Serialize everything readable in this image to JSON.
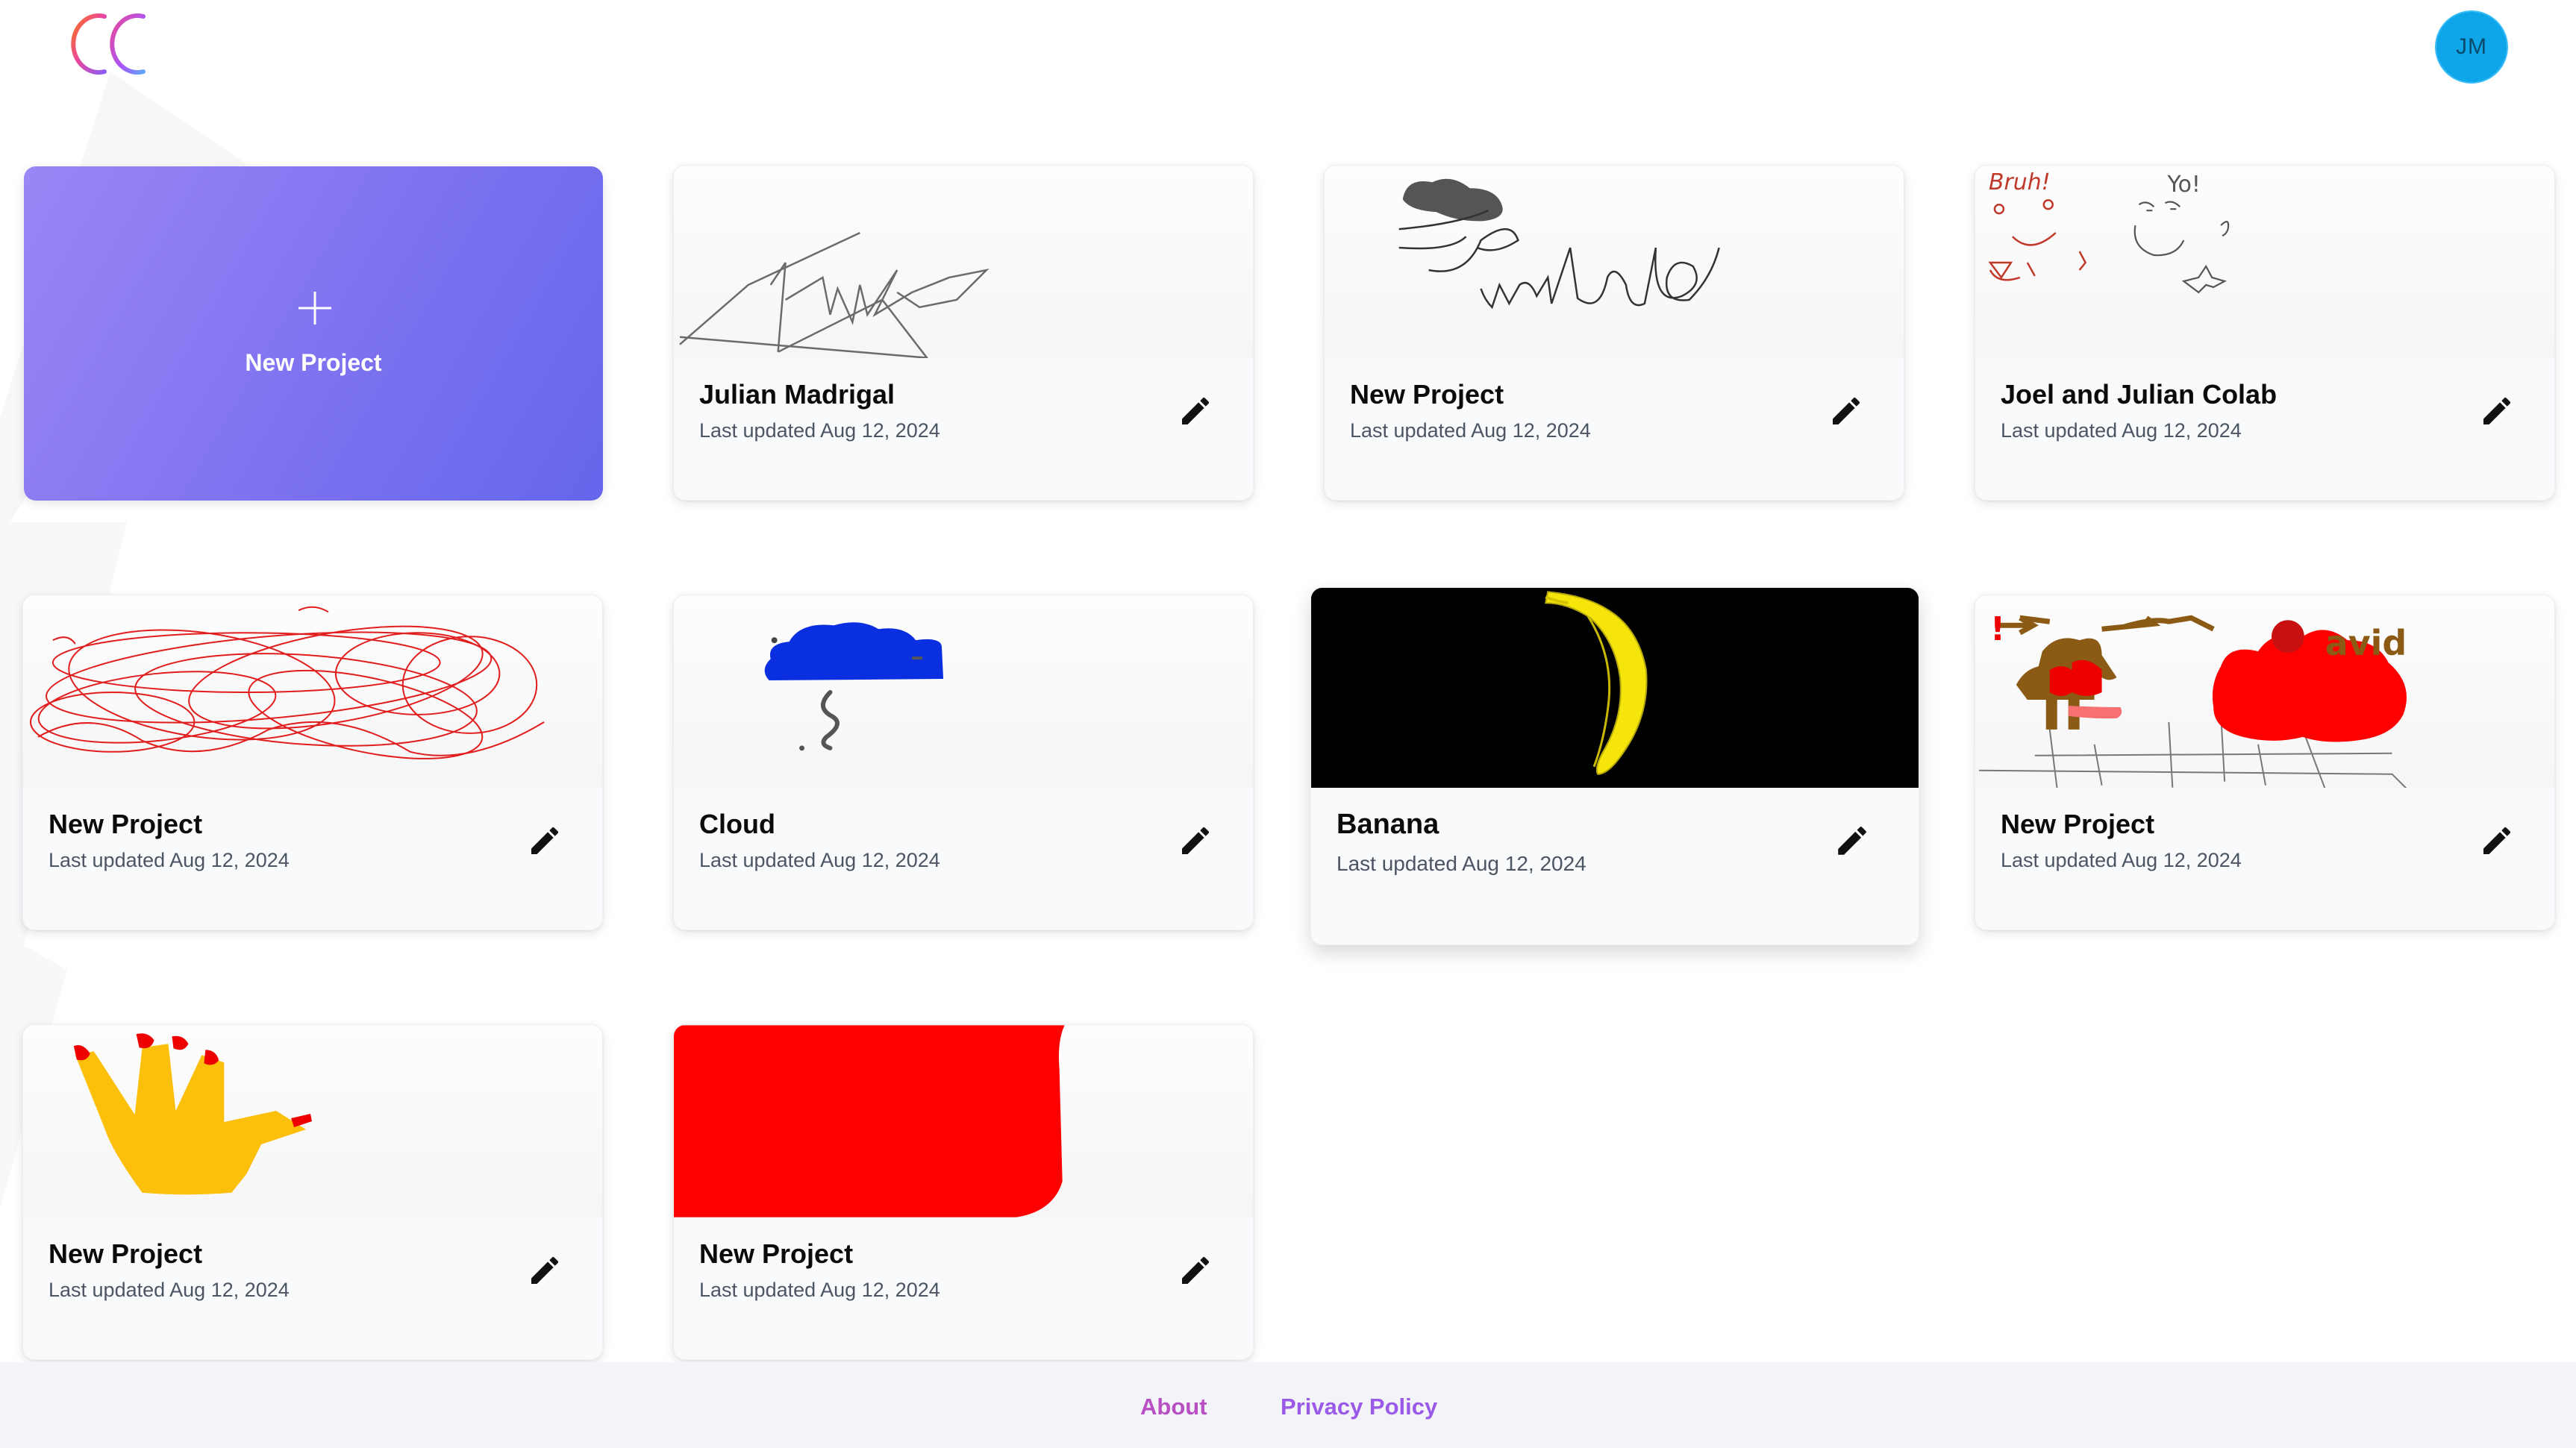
{
  "header": {
    "logo_icon": "cc-logo-icon",
    "avatar_initials": "JM"
  },
  "new_project_card": {
    "label": "New Project",
    "icon": "plus-icon"
  },
  "projects": [
    {
      "title": "Julian Madrigal",
      "updated": "Last updated Aug 12, 2024",
      "thumbnail": "signature-sketch"
    },
    {
      "title": "New Project",
      "updated": "Last updated Aug 12, 2024",
      "thumbnail": "cloud-hello-sketch"
    },
    {
      "title": "Joel and Julian Colab",
      "updated": "Last updated Aug 12, 2024",
      "thumbnail": "doodles-sketch"
    },
    {
      "title": "New Project",
      "updated": "Last updated Aug 12, 2024",
      "thumbnail": "red-scribble-sketch"
    },
    {
      "title": "Cloud",
      "updated": "Last updated Aug 12, 2024",
      "thumbnail": "blue-cloud-sketch"
    },
    {
      "title": "Banana",
      "updated": "Last updated Aug 12, 2024",
      "thumbnail": "banana-sketch"
    },
    {
      "title": "New Project",
      "updated": "Last updated Aug 12, 2024",
      "thumbnail": "david-sketch"
    },
    {
      "title": "New Project",
      "updated": "Last updated Aug 12, 2024",
      "thumbnail": "yellow-hand-sketch"
    },
    {
      "title": "New Project",
      "updated": "Last updated Aug 12, 2024",
      "thumbnail": "red-block-sketch"
    }
  ],
  "thumbnail_text": {
    "bruh": "Bruh!",
    "yo": "Yo!",
    "david": "avid"
  },
  "edit_icon": "pencil-icon",
  "footer": {
    "about": "About",
    "privacy": "Privacy Policy"
  },
  "colors": {
    "accent_gradient_start": "#9b86f5",
    "accent_gradient_end": "#6566ec",
    "avatar": "#0ea5e9",
    "footer_link_start": "#c04fc1",
    "footer_link_end": "#8e5ff0"
  }
}
